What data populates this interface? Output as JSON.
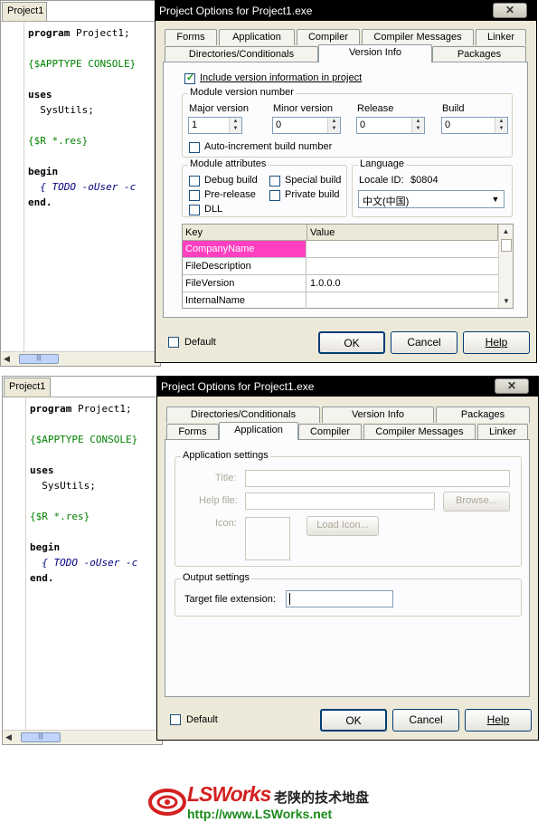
{
  "top": {
    "editor": {
      "tab": "Project1",
      "lines": {
        "l1_kw": "program",
        "l1_rest": " Project1;",
        "l2": "{$APPTYPE CONSOLE}",
        "l3": "uses",
        "l4": "  SysUtils;",
        "l5": "{$R *.res}",
        "l6": "begin",
        "l7": "  { TODO -oUser -c",
        "l8": "end."
      }
    },
    "dialog": {
      "title": "Project Options for Project1.exe",
      "close_glyph": "✕",
      "tabs_back": [
        "Forms",
        "Application",
        "Compiler",
        "Compiler Messages",
        "Linker"
      ],
      "tabs_front": [
        "Directories/Conditionals",
        "Version Info",
        "Packages"
      ],
      "active_tab": "Version Info",
      "include_version": "Include version information in project",
      "module_version_title": "Module version number",
      "major_label": "Major version",
      "major_value": "1",
      "minor_label": "Minor version",
      "minor_value": "0",
      "release_label": "Release",
      "release_value": "0",
      "build_label": "Build",
      "build_value": "0",
      "auto_increment": "Auto-increment build number",
      "module_attributes_title": "Module attributes",
      "debug_build": "Debug build",
      "pre_release": "Pre-release",
      "dll": "DLL",
      "special_build": "Special build",
      "private_build": "Private build",
      "language_title": "Language",
      "locale_label": "Locale ID:",
      "locale_value": "$0804",
      "language_value": "中文(中国)",
      "grid_key": "Key",
      "grid_value": "Value",
      "rows": [
        {
          "k": "CompanyName",
          "v": ""
        },
        {
          "k": "FileDescription",
          "v": ""
        },
        {
          "k": "FileVersion",
          "v": "1.0.0.0"
        },
        {
          "k": "InternalName",
          "v": ""
        }
      ],
      "selected_row_color": "#ff40c0",
      "default_label": "Default",
      "ok": "OK",
      "cancel": "Cancel",
      "help": "Help"
    }
  },
  "bottom": {
    "editor": {
      "tab": "Project1",
      "lines": {
        "l1_kw": "program",
        "l1_rest": " Project1;",
        "l2": "{$APPTYPE CONSOLE}",
        "l3": "uses",
        "l4": "  SysUtils;",
        "l5": "{$R *.res}",
        "l6": "begin",
        "l7": "  { TODO -oUser -c",
        "l8": "end."
      }
    },
    "dialog": {
      "title": "Project Options for Project1.exe",
      "close_glyph": "✕",
      "tabs_back": [
        "Directories/Conditionals",
        "Version Info",
        "Packages"
      ],
      "tabs_front": [
        "Forms",
        "Application",
        "Compiler",
        "Compiler Messages",
        "Linker"
      ],
      "active_tab": "Application",
      "app_settings_title": "Application settings",
      "title_label": "Title:",
      "helpfile_label": "Help file:",
      "browse": "Browse...",
      "icon_label": "Icon:",
      "load_icon": "Load Icon...",
      "output_settings_title": "Output settings",
      "target_ext_label": "Target file extension:",
      "target_ext_value": "",
      "default_label": "Default",
      "ok": "OK",
      "cancel": "Cancel",
      "help": "Help"
    }
  },
  "watermark": {
    "brand": "LSWorks",
    "chinese": "老陕的技术地盘",
    "url": "http://www.LSWorks.net",
    "brand_color": "#d42020",
    "url_color": "#1a8a1a"
  }
}
